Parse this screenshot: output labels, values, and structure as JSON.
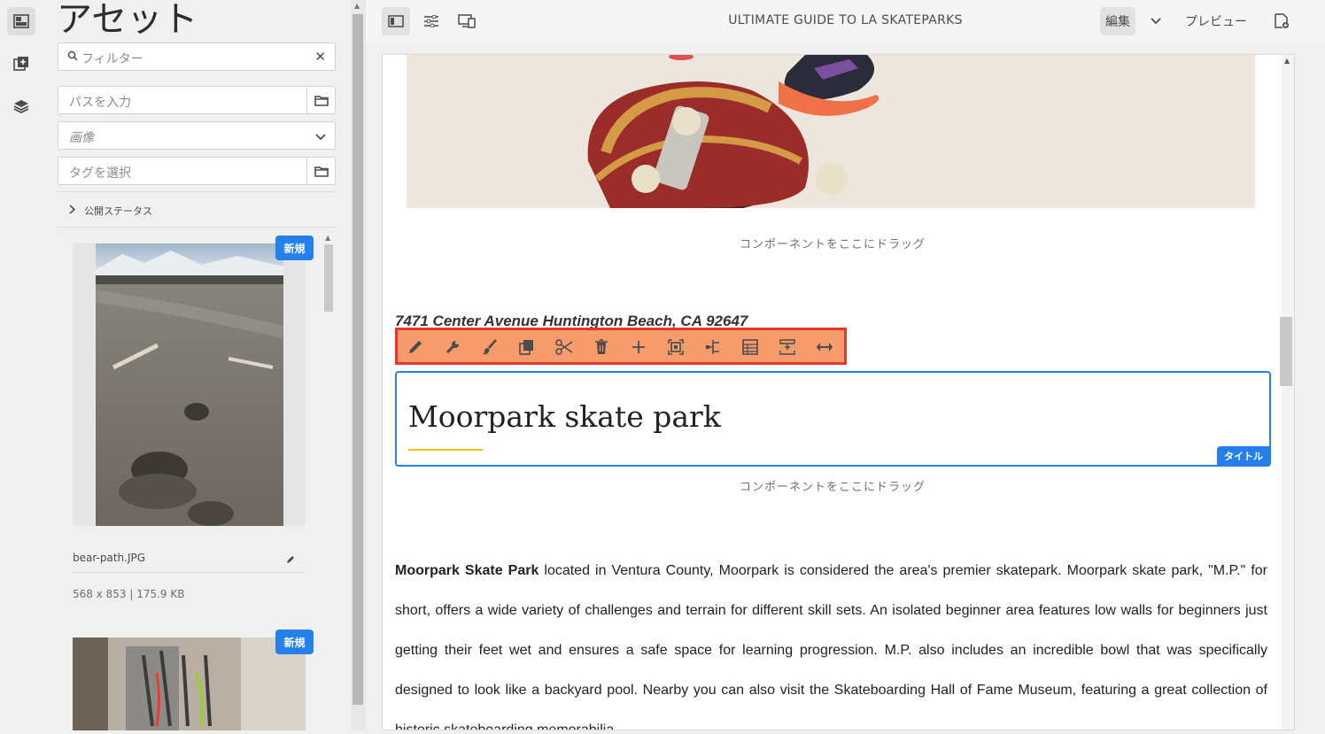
{
  "panel": {
    "title": "アセット",
    "filter_placeholder": "フィルター",
    "path_placeholder": "パスを入力",
    "type_value": "画像",
    "tags_placeholder": "タグを選択",
    "publish_status": "公開ステータス"
  },
  "assets": [
    {
      "badge": "新規",
      "filename": "bear-path.JPG",
      "meta": "568 x 853 | 175.9 KB"
    },
    {
      "badge": "新規"
    }
  ],
  "topbar": {
    "page_title": "ULTIMATE GUIDE TO LA SKATEPARKS",
    "edit_label": "編集",
    "preview_label": "プレビュー"
  },
  "canvas": {
    "drop_hint_1": "コンポーネントをここにドラッグ",
    "address": "7471 Center Avenue Huntington Beach, CA 92647",
    "title_heading": "Moorpark skate park",
    "title_component_label": "タイトル",
    "drop_hint_2": "コンポーネントをここにドラッグ",
    "body_bold": "Moorpark Skate Park",
    "body_text": " located in Ventura County, Moorpark is considered the area's premier skatepark. Moorpark skate park, \"M.P.\" for short, offers a wide variety of challenges and terrain for different skill sets. An isolated beginner area features low walls for beginners just getting their feet wet and ensures a safe space for learning progression. M.P. also includes an incredible bowl that was specifically designed to look like a backyard pool. Nearby you can also visit the Skateboarding Hall of Fame Museum, featuring a great collection of historic skateboarding memorabilia."
  },
  "toolbar_icons": [
    "edit-icon",
    "configure-icon",
    "style-icon",
    "copy-icon",
    "cut-icon",
    "delete-icon",
    "insert-icon",
    "select-parent-icon",
    "group-icon",
    "layout-icon",
    "add-to-template-icon",
    "layout-resize-icon"
  ],
  "colors": {
    "accent": "#2680eb",
    "toolbar_border": "#e8372a",
    "toolbar_bg": "#f59b6c",
    "underline": "#f2c200"
  }
}
